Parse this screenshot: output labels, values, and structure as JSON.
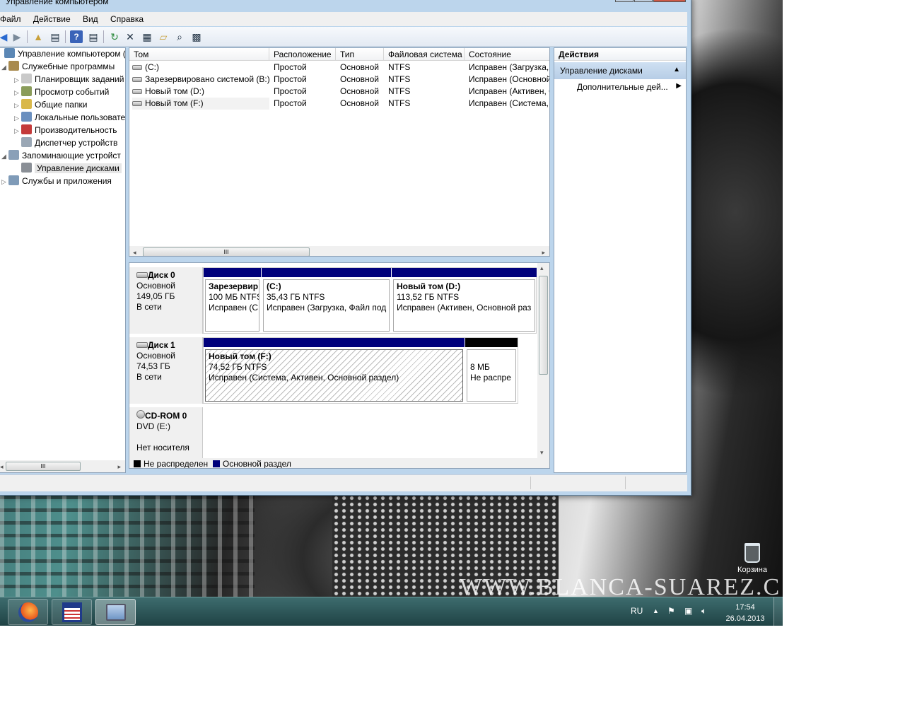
{
  "window": {
    "title": "Управление компьютером"
  },
  "menu": [
    "Файл",
    "Действие",
    "Вид",
    "Справка"
  ],
  "tree": [
    {
      "label": "Управление компьютером (л",
      "level": 0,
      "expander": "",
      "icon": "computer-management-icon",
      "color": "#5b87b5"
    },
    {
      "label": "Служебные программы",
      "level": 1,
      "expander": "◢",
      "icon": "tools-icon",
      "color": "#a88a4e"
    },
    {
      "label": "Планировщик заданий",
      "level": 2,
      "expander": "▷",
      "icon": "clock-icon",
      "color": "#c9c9c9"
    },
    {
      "label": "Просмотр событий",
      "level": 2,
      "expander": "▷",
      "icon": "event-viewer-icon",
      "color": "#8a9c5a"
    },
    {
      "label": "Общие папки",
      "level": 2,
      "expander": "▷",
      "icon": "shared-folder-icon",
      "color": "#d9b84a"
    },
    {
      "label": "Локальные пользовате",
      "level": 2,
      "expander": "▷",
      "icon": "users-icon",
      "color": "#6a8fbf"
    },
    {
      "label": "Производительность",
      "level": 2,
      "expander": "▷",
      "icon": "performance-icon",
      "color": "#c43a3a"
    },
    {
      "label": "Диспетчер устройств",
      "level": 2,
      "expander": "",
      "icon": "device-manager-icon",
      "color": "#9aa7b5"
    },
    {
      "label": "Запоминающие устройст",
      "level": 1,
      "expander": "◢",
      "icon": "storage-icon",
      "color": "#8aa0b8"
    },
    {
      "label": "Управление дисками",
      "level": 2,
      "expander": "",
      "icon": "disk-management-icon",
      "color": "#8a8f96",
      "selected": true
    },
    {
      "label": "Службы и приложения",
      "level": 1,
      "expander": "▷",
      "icon": "services-icon",
      "color": "#7f9bb8"
    }
  ],
  "list": {
    "columns": [
      "Том",
      "Расположение",
      "Тип",
      "Файловая система",
      "Состояние"
    ],
    "rows": [
      [
        "(C:)",
        "Простой",
        "Основной",
        "NTFS",
        "Исправен (Загрузка,"
      ],
      [
        "Зарезервировано системой (B:)",
        "Простой",
        "Основной",
        "NTFS",
        "Исправен (Основной"
      ],
      [
        "Новый том (D:)",
        "Простой",
        "Основной",
        "NTFS",
        "Исправен (Активен, О"
      ],
      [
        "Новый том (F:)",
        "Простой",
        "Основной",
        "NTFS",
        "Исправен (Система,"
      ]
    ],
    "scroll_grip": "III"
  },
  "disks": [
    {
      "name": "Диск 0",
      "type": "Основной",
      "size": "149,05 ГБ",
      "status": "В сети",
      "partitions": [
        {
          "name": "Зарезервир",
          "size": "100 МБ NTFS",
          "status": "Исправен (С",
          "kind": "primary"
        },
        {
          "name": "(C:)",
          "size": "35,43 ГБ NTFS",
          "status": "Исправен (Загрузка, Файл под",
          "kind": "primary"
        },
        {
          "name": "Новый том  (D:)",
          "size": "113,52 ГБ NTFS",
          "status": "Исправен (Активен, Основной раз",
          "kind": "primary"
        }
      ]
    },
    {
      "name": "Диск 1",
      "type": "Основной",
      "size": "74,53 ГБ",
      "status": "В сети",
      "partitions": [
        {
          "name": "Новый том  (F:)",
          "size": "74,52 ГБ NTFS",
          "status": "Исправен (Система, Активен, Основной раздел)",
          "kind": "primary"
        },
        {
          "name": "",
          "size": "8 МБ",
          "status": "Не распре",
          "kind": "unallocated"
        }
      ]
    }
  ],
  "cdrom": {
    "name": "CD-ROM 0",
    "drive": "DVD (E:)",
    "status": "Нет носителя"
  },
  "legend": [
    {
      "label": "Не распределен",
      "color": "#000000"
    },
    {
      "label": "Основной раздел",
      "color": "#00007b"
    }
  ],
  "actions": {
    "header": "Действия",
    "section": "Управление дисками",
    "item": "Дополнительные дей..."
  },
  "desktop": {
    "watermark": "WWW.BLANCA-SUAREZ.C",
    "recycle_bin": "Корзина"
  },
  "taskbar": {
    "lang": "RU",
    "time": "17:54",
    "date": "26.04.2013"
  },
  "colors": {
    "primary_partition": "#00007b",
    "unallocated": "#000000",
    "selection": "#b7cde6"
  }
}
